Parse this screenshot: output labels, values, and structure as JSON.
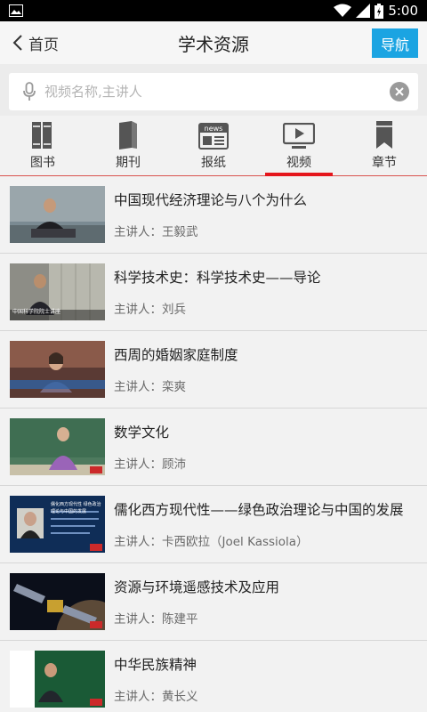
{
  "status": {
    "time": "5:00"
  },
  "header": {
    "back_label": "首页",
    "title": "学术资源",
    "nav_label": "导航"
  },
  "search": {
    "placeholder": "视频名称,主讲人"
  },
  "tabs": [
    {
      "label": "图书",
      "icon": "books-icon"
    },
    {
      "label": "期刊",
      "icon": "journal-icon"
    },
    {
      "label": "报纸",
      "icon": "newspaper-icon"
    },
    {
      "label": "视频",
      "icon": "video-icon",
      "active": true
    },
    {
      "label": "章节",
      "icon": "bookmark-icon"
    }
  ],
  "videos": [
    {
      "title": "中国现代经济理论与八个为什么",
      "speaker": "主讲人：王毅武"
    },
    {
      "title": "科学技术史：科学技术史——导论",
      "speaker": "主讲人：刘兵"
    },
    {
      "title": "西周的婚姻家庭制度",
      "speaker": "主讲人：栾爽"
    },
    {
      "title": "数学文化",
      "speaker": "主讲人：顾沛"
    },
    {
      "title": "儒化西方现代性——绿色政治理论与中国的发展",
      "speaker": "主讲人：卡西欧拉（Joel Kassiola）"
    },
    {
      "title": "资源与环境遥感技术及应用",
      "speaker": "主讲人：陈建平"
    },
    {
      "title": "中华民族精神",
      "speaker": "主讲人：黄长义"
    }
  ],
  "thumb_overlays": {
    "v2": "中国科学院院士讲座",
    "v5": "儒化西方现代性 绿色政治理论与中国的发展"
  }
}
